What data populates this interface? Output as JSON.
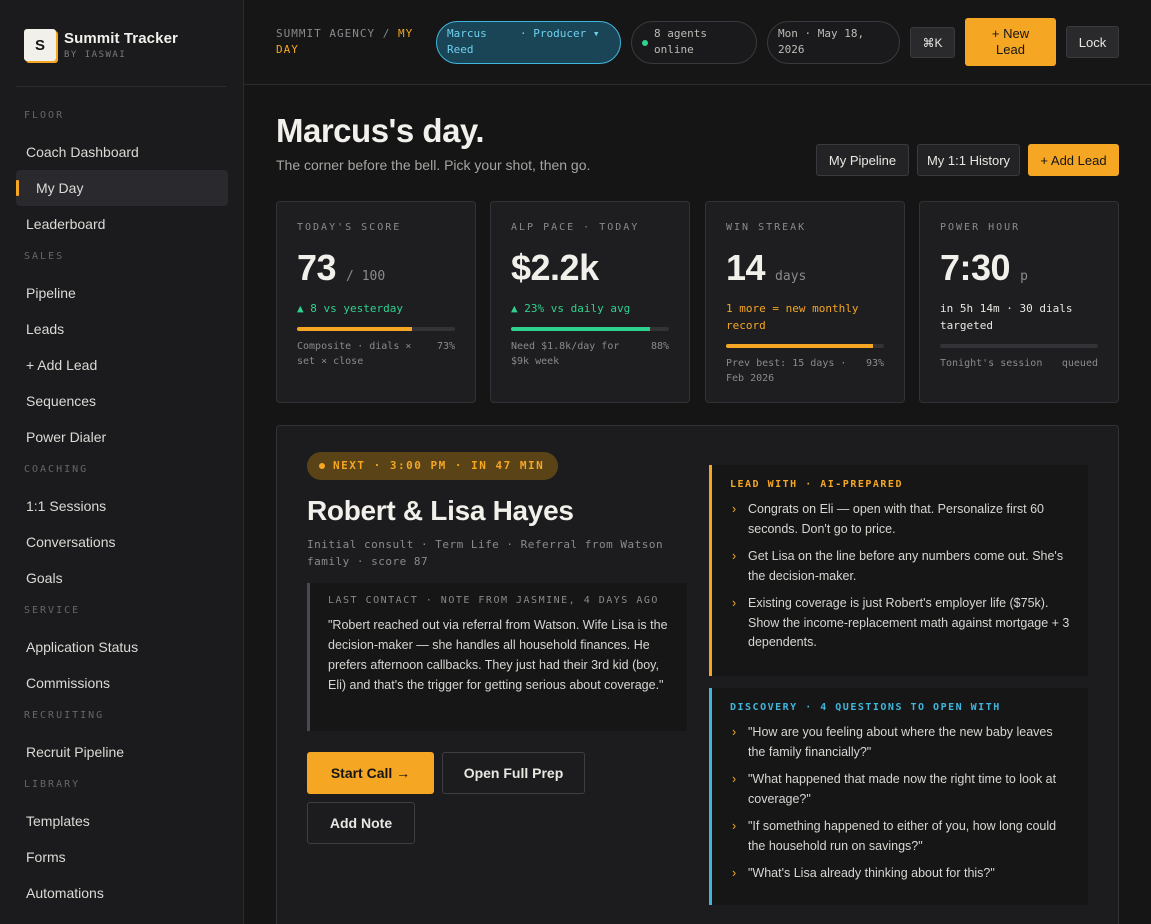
{
  "brand": {
    "logo_letter": "S",
    "name": "Summit Tracker",
    "sub": "BY IASWAI"
  },
  "nav": {
    "groups": [
      {
        "label": "FLOOR",
        "items": [
          "Coach Dashboard",
          "My Day",
          "Leaderboard"
        ]
      },
      {
        "label": "SALES",
        "items": [
          "Pipeline",
          "Leads",
          "+ Add Lead",
          "Sequences",
          "Power Dialer"
        ]
      },
      {
        "label": "COACHING",
        "items": [
          "1:1 Sessions",
          "Conversations",
          "Goals"
        ]
      },
      {
        "label": "SERVICE",
        "items": [
          "Application Status",
          "Commissions"
        ]
      },
      {
        "label": "RECRUITING",
        "items": [
          "Recruit Pipeline"
        ]
      },
      {
        "label": "LIBRARY",
        "items": [
          "Templates",
          "Forms",
          "Automations"
        ]
      }
    ],
    "active": "My Day"
  },
  "topbar": {
    "crumb_root": "SUMMIT AGENCY /",
    "crumb_current": "MY DAY",
    "user_name": "Marcus Reed",
    "user_role": "· Producer ▾",
    "agents_online": "8 agents online",
    "date": "Mon · May 18, 2026",
    "search_shortcut": "⌘K",
    "new_lead_label": "+ New Lead",
    "lock_label": "Lock"
  },
  "header": {
    "title": "Marcus's day.",
    "subtitle": "The corner before the bell. Pick your shot, then go.",
    "btn_pipeline": "My Pipeline",
    "btn_history": "My 1:1 History",
    "btn_add_lead": "+ Add Lead"
  },
  "stats": [
    {
      "label": "TODAY'S SCORE",
      "value": "73",
      "unit": "/ 100",
      "delta": "▲ 8 vs yesterday",
      "delta_color": "#2fd18f",
      "progress": 0.73,
      "bar_color": "#f5a623",
      "foot": "Composite · dials × set × close",
      "foot_pct": "73%"
    },
    {
      "label": "ALP PACE · TODAY",
      "value": "$2.2k",
      "unit": "",
      "delta": "▲ 23% vs daily avg",
      "delta_color": "#2fd18f",
      "progress": 0.88,
      "bar_color": "#2fd18f",
      "foot": "Need $1.8k/day for $9k week",
      "foot_pct": "88%"
    },
    {
      "label": "WIN STREAK",
      "value": "14",
      "unit": "days",
      "delta": "1 more = new monthly record",
      "delta_color": "#f5a623",
      "progress": 0.93,
      "bar_color": "#f5a623",
      "foot": "Prev best: 15 days · Feb 2026",
      "foot_pct": "93%"
    },
    {
      "label": "POWER HOUR",
      "value": "7:30",
      "unit": "p",
      "delta": "in 5h 14m · 30 dials targeted",
      "delta_color": "#e9e7e2",
      "progress": 0,
      "bar_color": "#f5a623",
      "foot": "Tonight's session",
      "foot_pct": "queued"
    }
  ],
  "next": {
    "badge": "NEXT · 3:00 PM · IN 47 MIN",
    "name": "Robert & Lisa Hayes",
    "meta": "Initial consult · Term Life · Referral from Watson family · score 87",
    "contact_label": "LAST CONTACT · NOTE FROM JASMINE, 4 DAYS AGO",
    "contact_quote": "\"Robert reached out via referral from Watson. Wife Lisa is the decision-maker — she handles all household finances. He prefers afternoon callbacks. They just had their 3rd kid (boy, Eli) and that's the trigger for getting serious about coverage.\"",
    "btn_start": "Start Call →",
    "btn_prep": "Open Full Prep",
    "btn_note": "Add Note",
    "lead_with_label": "LEAD WITH · AI-PREPARED",
    "lead_with": [
      "Congrats on Eli — open with that. Personalize first 60 seconds. Don't go to price.",
      "Get Lisa on the line before any numbers come out. She's the decision-maker.",
      "Existing coverage is just Robert's employer life ($75k). Show the income-replacement math against mortgage + 3 dependents."
    ],
    "discovery_label": "DISCOVERY · 4 QUESTIONS TO OPEN WITH",
    "discovery": [
      "\"How are you feeling about where the new baby leaves the family financially?\"",
      "\"What happened that made now the right time to look at coverage?\"",
      "\"If something happened to either of you, how long could the household run on savings?\"",
      "\"What's Lisa already thinking about for this?\""
    ],
    "chevron": "›"
  }
}
